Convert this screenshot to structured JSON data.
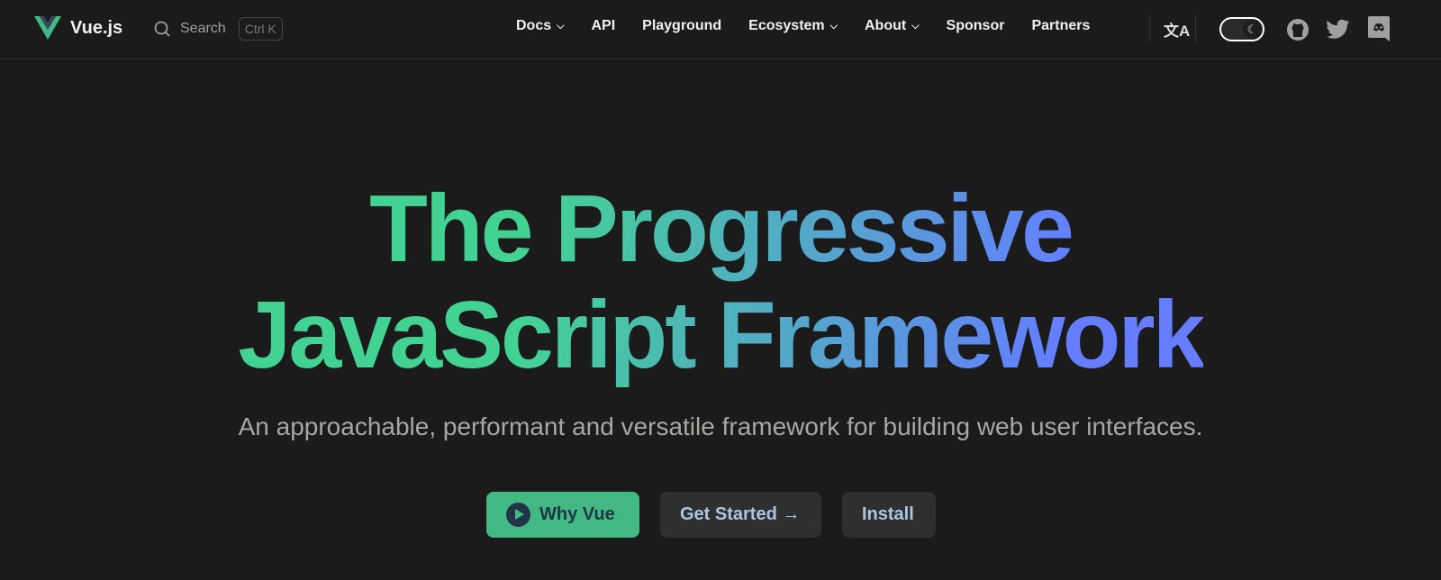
{
  "nav": {
    "brand": "Vue.js",
    "search_label": "Search",
    "search_shortcut": "Ctrl K",
    "items": [
      {
        "label": "Docs",
        "dropdown": true
      },
      {
        "label": "API"
      },
      {
        "label": "Playground"
      },
      {
        "label": "Ecosystem",
        "dropdown": true
      },
      {
        "label": "About",
        "dropdown": true
      },
      {
        "label": "Sponsor"
      },
      {
        "label": "Partners"
      }
    ],
    "theme": "dark"
  },
  "hero": {
    "title_line1": "The Progressive",
    "title_line2": "JavaScript Framework",
    "tagline": "An approachable, performant and versatile framework for building web user interfaces.",
    "buttons": {
      "why": "Why Vue",
      "start": "Get Started →",
      "install": "Install"
    }
  },
  "colors": {
    "accent": "#42b883",
    "bg": "#1b1b1b"
  }
}
